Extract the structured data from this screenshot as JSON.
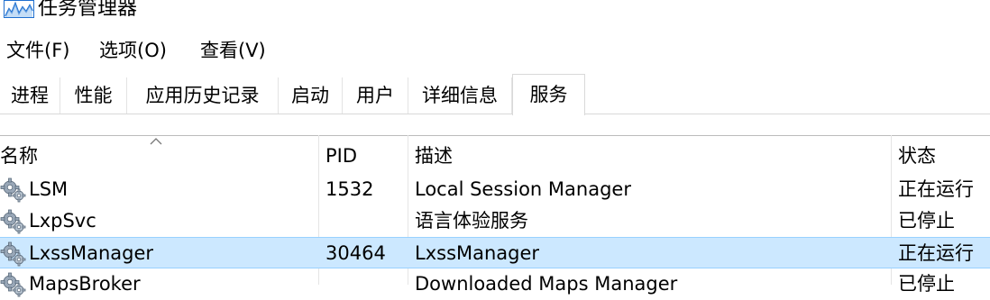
{
  "window": {
    "title": "任务管理器",
    "app_icon": "performance-graph-icon"
  },
  "menu": {
    "items": [
      "文件(F)",
      "选项(O)",
      "查看(V)"
    ]
  },
  "tabs": {
    "items": [
      "进程",
      "性能",
      "应用历史记录",
      "启动",
      "用户",
      "详细信息",
      "服务"
    ],
    "active": "服务"
  },
  "services": {
    "sort_column": "名称",
    "columns": {
      "name": "名称",
      "pid": "PID",
      "description": "描述",
      "status": "状态"
    },
    "rows": [
      {
        "name": "LSM",
        "pid": "1532",
        "description": "Local Session Manager",
        "status": "正在运行",
        "selected": false
      },
      {
        "name": "LxpSvc",
        "pid": "",
        "description": "语言体验服务",
        "status": "已停止",
        "selected": false
      },
      {
        "name": "LxssManager",
        "pid": "30464",
        "description": "LxssManager",
        "status": "正在运行",
        "selected": true
      },
      {
        "name": "MapsBroker",
        "pid": "",
        "description": "Downloaded Maps Manager",
        "status": "已停止",
        "selected": false
      }
    ]
  },
  "colors": {
    "selection_bg": "#cce8ff",
    "selection_border": "#99d1ff",
    "icon_blue": "#1f6fcf"
  }
}
